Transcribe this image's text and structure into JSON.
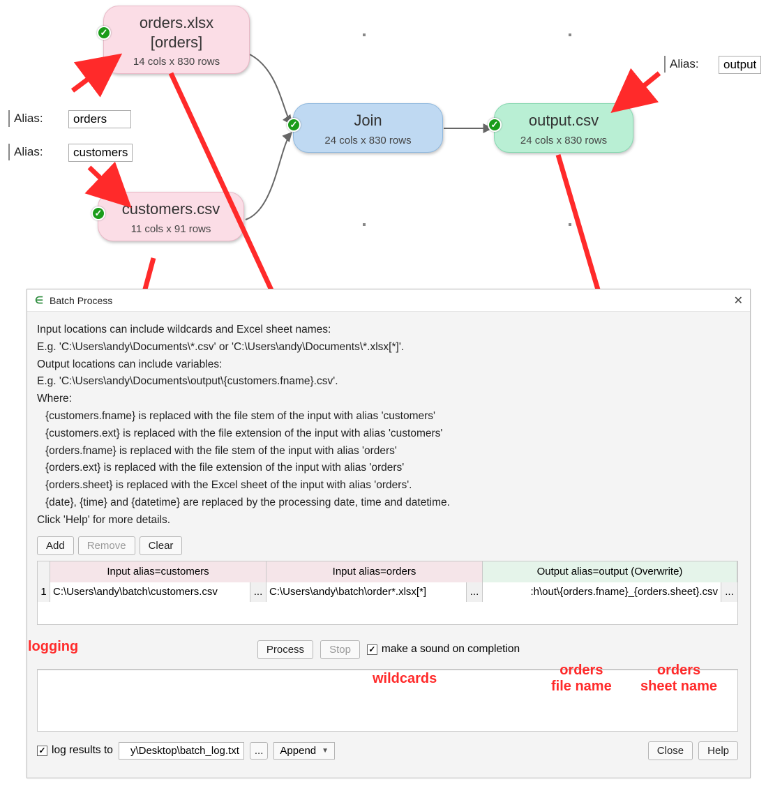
{
  "nodes": {
    "orders": {
      "title1": "orders.xlsx",
      "title2": "[orders]",
      "sub": "14 cols x 830 rows"
    },
    "customers": {
      "title": "customers.csv",
      "sub": "11 cols x 91 rows"
    },
    "join": {
      "title": "Join",
      "sub": "24 cols x 830 rows"
    },
    "output": {
      "title": "output.csv",
      "sub": "24 cols x 830 rows"
    }
  },
  "alias_labels": {
    "label": "Alias:"
  },
  "alias_fields": {
    "orders": "orders",
    "customers": "customers",
    "output": "output"
  },
  "dialog": {
    "title": "Batch Process",
    "help": {
      "l1": "Input locations can include wildcards and Excel sheet names:",
      "l2": "E.g. 'C:\\Users\\andy\\Documents\\*.csv' or 'C:\\Users\\andy\\Documents\\*.xlsx[*]'.",
      "l3": "Output locations can include variables:",
      "l4": "E.g. 'C:\\Users\\andy\\Documents\\output\\{customers.fname}.csv'.",
      "l5": "Where:",
      "l6": "{customers.fname} is replaced with the file stem of the input with alias 'customers'",
      "l7": "{customers.ext} is replaced with the file extension of the input with alias 'customers'",
      "l8": "{orders.fname} is replaced with the file stem of the input with alias 'orders'",
      "l9": "{orders.ext} is replaced with the file extension of the input with alias 'orders'",
      "l10": "{orders.sheet} is replaced with the Excel sheet of the input with alias 'orders'.",
      "l11": "{date}, {time} and {datetime} are replaced by the processing date, time and datetime.",
      "l12": "Click 'Help' for more details."
    },
    "buttons": {
      "add": "Add",
      "remove": "Remove",
      "clear": "Clear",
      "process": "Process",
      "stop": "Stop",
      "close": "Close",
      "help": "Help",
      "browse": "..."
    },
    "grid": {
      "h1": "Input alias=customers",
      "h2": "Input alias=orders",
      "h3": "Output alias=output (Overwrite)",
      "rownum": "1",
      "c1": "C:\\Users\\andy\\batch\\customers.csv",
      "c2": "C:\\Users\\andy\\batch\\order*.xlsx[*]",
      "c3": ":h\\out\\{orders.fname}_{orders.sheet}.csv"
    },
    "sound_label": "make a sound on completion",
    "log_label": "log results to",
    "log_path": "y\\Desktop\\batch_log.txt",
    "append": "Append"
  },
  "annotations": {
    "logging": "logging",
    "wildcards": "wildcards",
    "fname": "orders\nfile name",
    "sheet": "orders\nsheet name"
  }
}
